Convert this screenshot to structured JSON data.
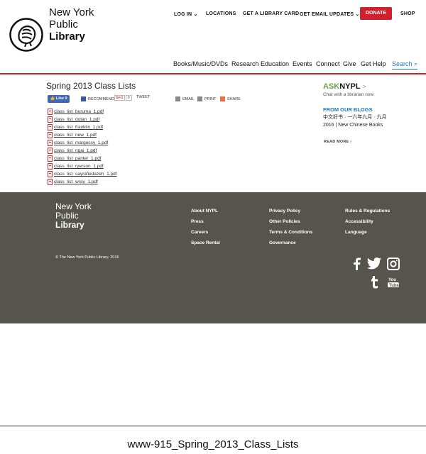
{
  "brand": {
    "line1": "New York",
    "line2": "Public",
    "line3": "Library"
  },
  "topnav": {
    "login": "LOG IN",
    "locations": "LOCATIONS",
    "library_card": "GET A LIBRARY CARD",
    "email_updates": "GET EMAIL UPDATES",
    "donate": "DONATE",
    "shop": "SHOP"
  },
  "mainnav": {
    "items": [
      "Books/Music/DVDs",
      "Research",
      "Education",
      "Events",
      "Connect",
      "Give",
      "Get Help"
    ],
    "search": "Search"
  },
  "page": {
    "title": "Spring 2013 Class Lists"
  },
  "share": {
    "like": "Like 0",
    "recommend": "RECOMMEND",
    "gplus": "G+1",
    "gplus_count": "0",
    "tweet": "TWEET",
    "email": "EMAIL",
    "print": "PRINT",
    "share": "SHARE"
  },
  "files": [
    "class_list_buruma_1.pdf",
    "class_list_dotan_1.pdf",
    "class_list_franklin_1.pdf",
    "class_list_new_1.pdf",
    "class_list_margocsy_1.pdf",
    "class_list_ngai_1.pdf",
    "class_list_panter_1.pdf",
    "class_list_ryerson_1.pdf",
    "class_list_sayrafiedazeh_1.pdf",
    "class_list_wray_1.pdf"
  ],
  "sidebar": {
    "ask_a": "ASK",
    "ask_b": "NYPL",
    "ask_arrow": ">",
    "ask_sub": "Chat with a librarian now",
    "blogs_heading": "FROM OUR BLOGS",
    "blog_title": "中文好书 · 一六年九月 · 九月 2016 | New Chinese Books",
    "read_more": "READ MORE ›"
  },
  "footer": {
    "col1": [
      "About NYPL",
      "Press",
      "Careers",
      "Space Rental"
    ],
    "col2": [
      "Privacy Policy",
      "Other Policies",
      "Terms & Conditions",
      "Governance"
    ],
    "col3": [
      "Rules & Regulations",
      "Accessibility",
      "Language"
    ],
    "copyright": "© The New York Public Library, 2016",
    "social": [
      "facebook-icon",
      "twitter-icon",
      "instagram-icon",
      "tumblr-icon",
      "youtube-icon"
    ]
  },
  "caption": "www-915_Spring_2013_Class_Lists",
  "colors": {
    "accent_red": "#d0202e",
    "link_blue": "#1f7ac0",
    "footer_bg": "#56544c",
    "ask_green": "#6aa34a"
  }
}
